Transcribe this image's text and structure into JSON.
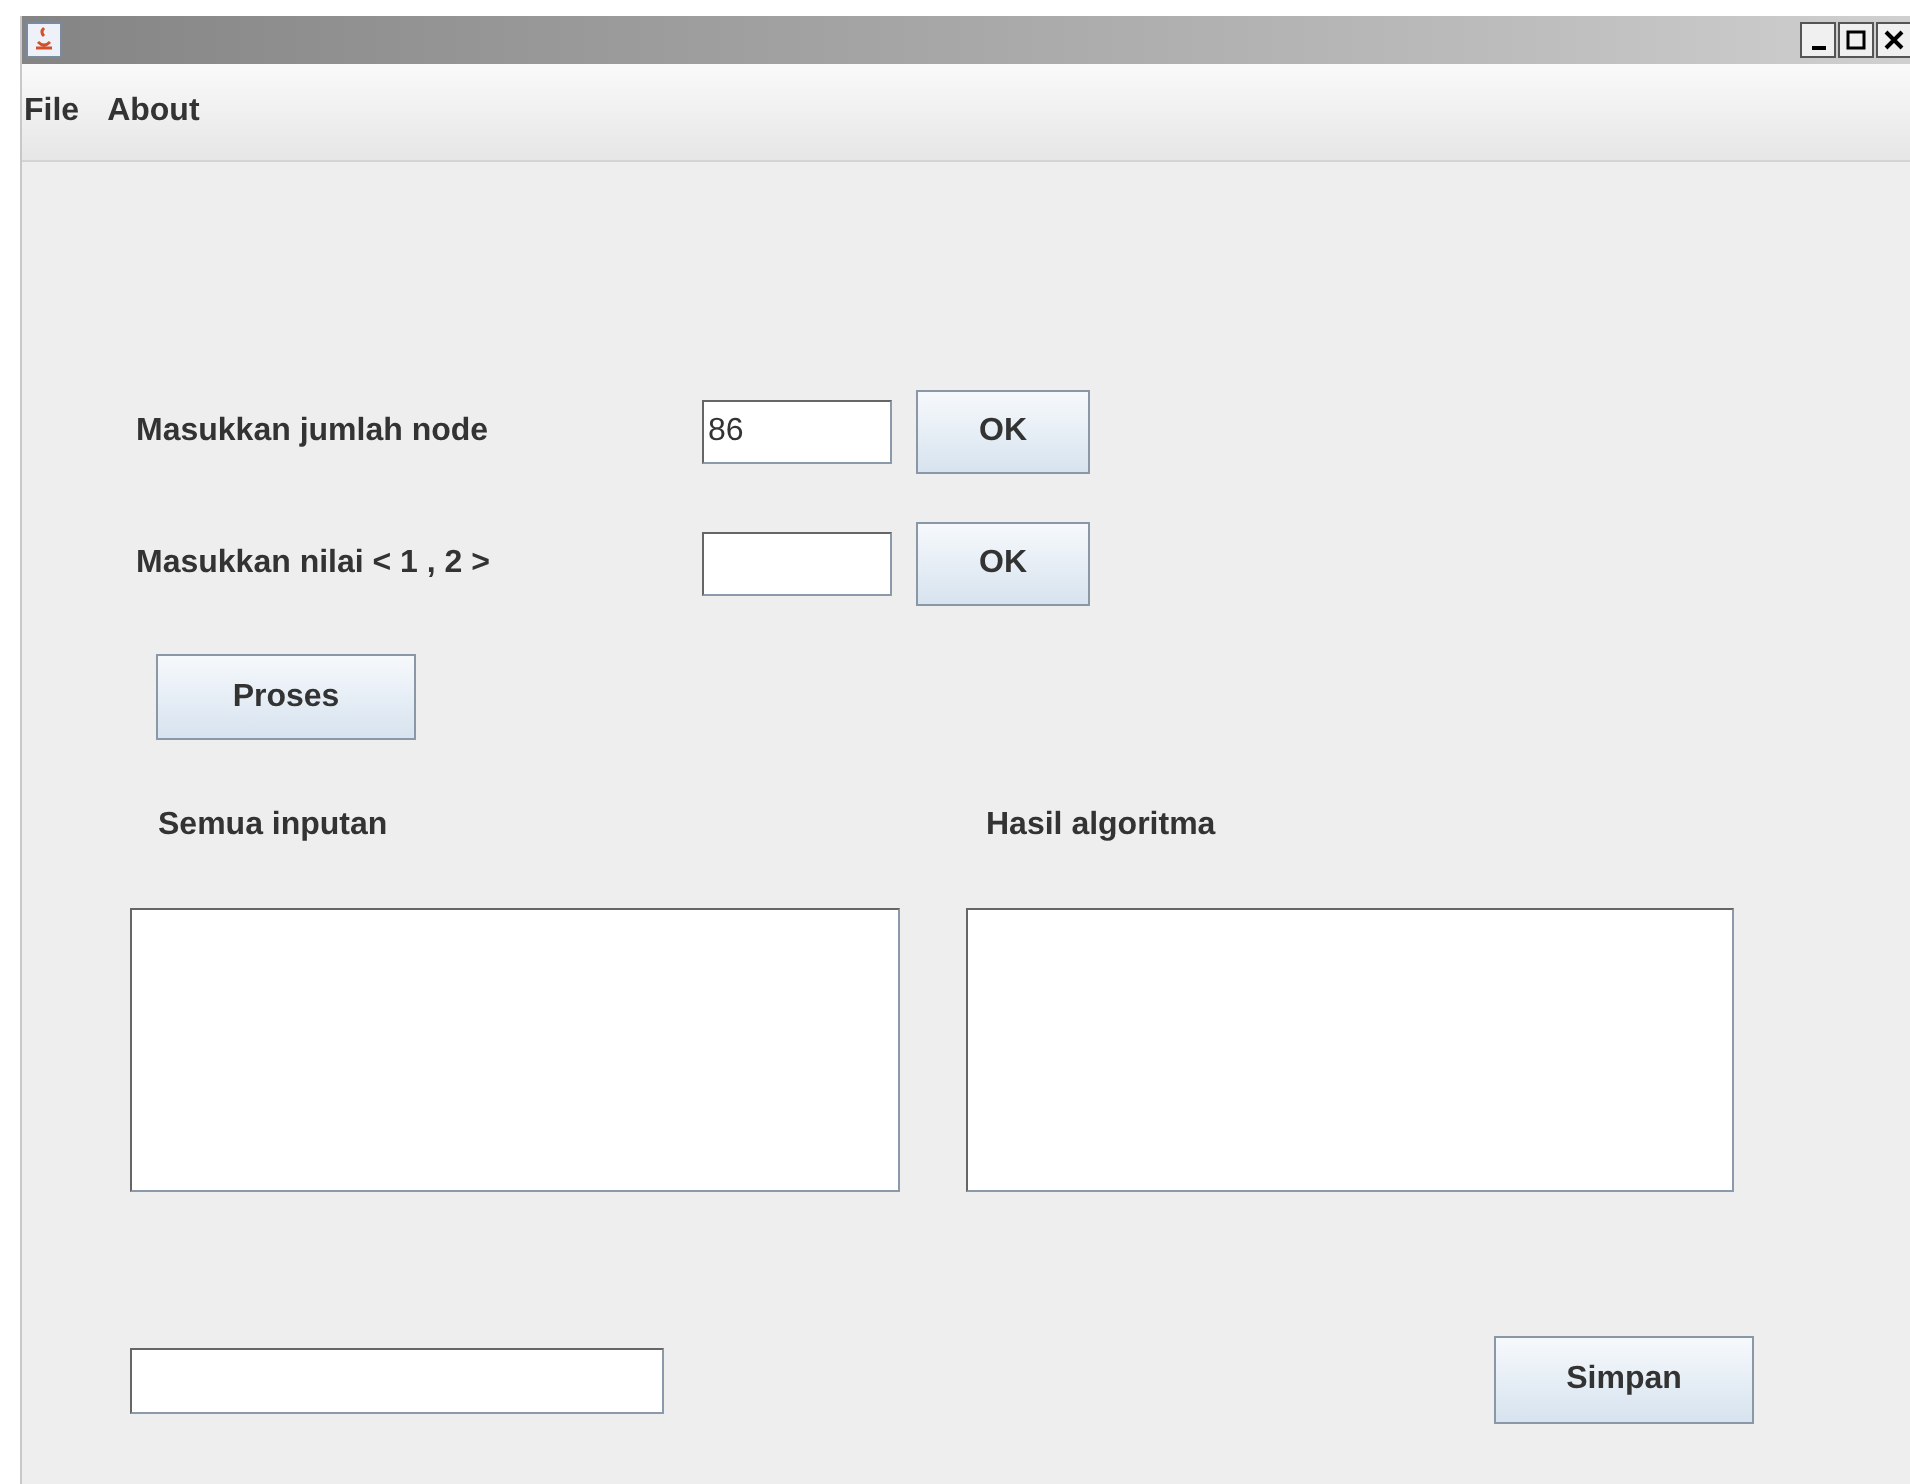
{
  "menu": [
    {
      "label": "File"
    },
    {
      "label": "About"
    }
  ],
  "inputs": [
    {
      "label": "Masukkan jumlah node",
      "value": "86",
      "button": "OK"
    },
    {
      "label": "Masukkan nilai < 1 , 2 >",
      "button": "OK"
    }
  ],
  "process_button": "Proses",
  "panels": [
    {
      "label": "Semua inputan"
    },
    {
      "label": "Hasil algoritma"
    }
  ],
  "bottom": {
    "button": "Simpan"
  }
}
